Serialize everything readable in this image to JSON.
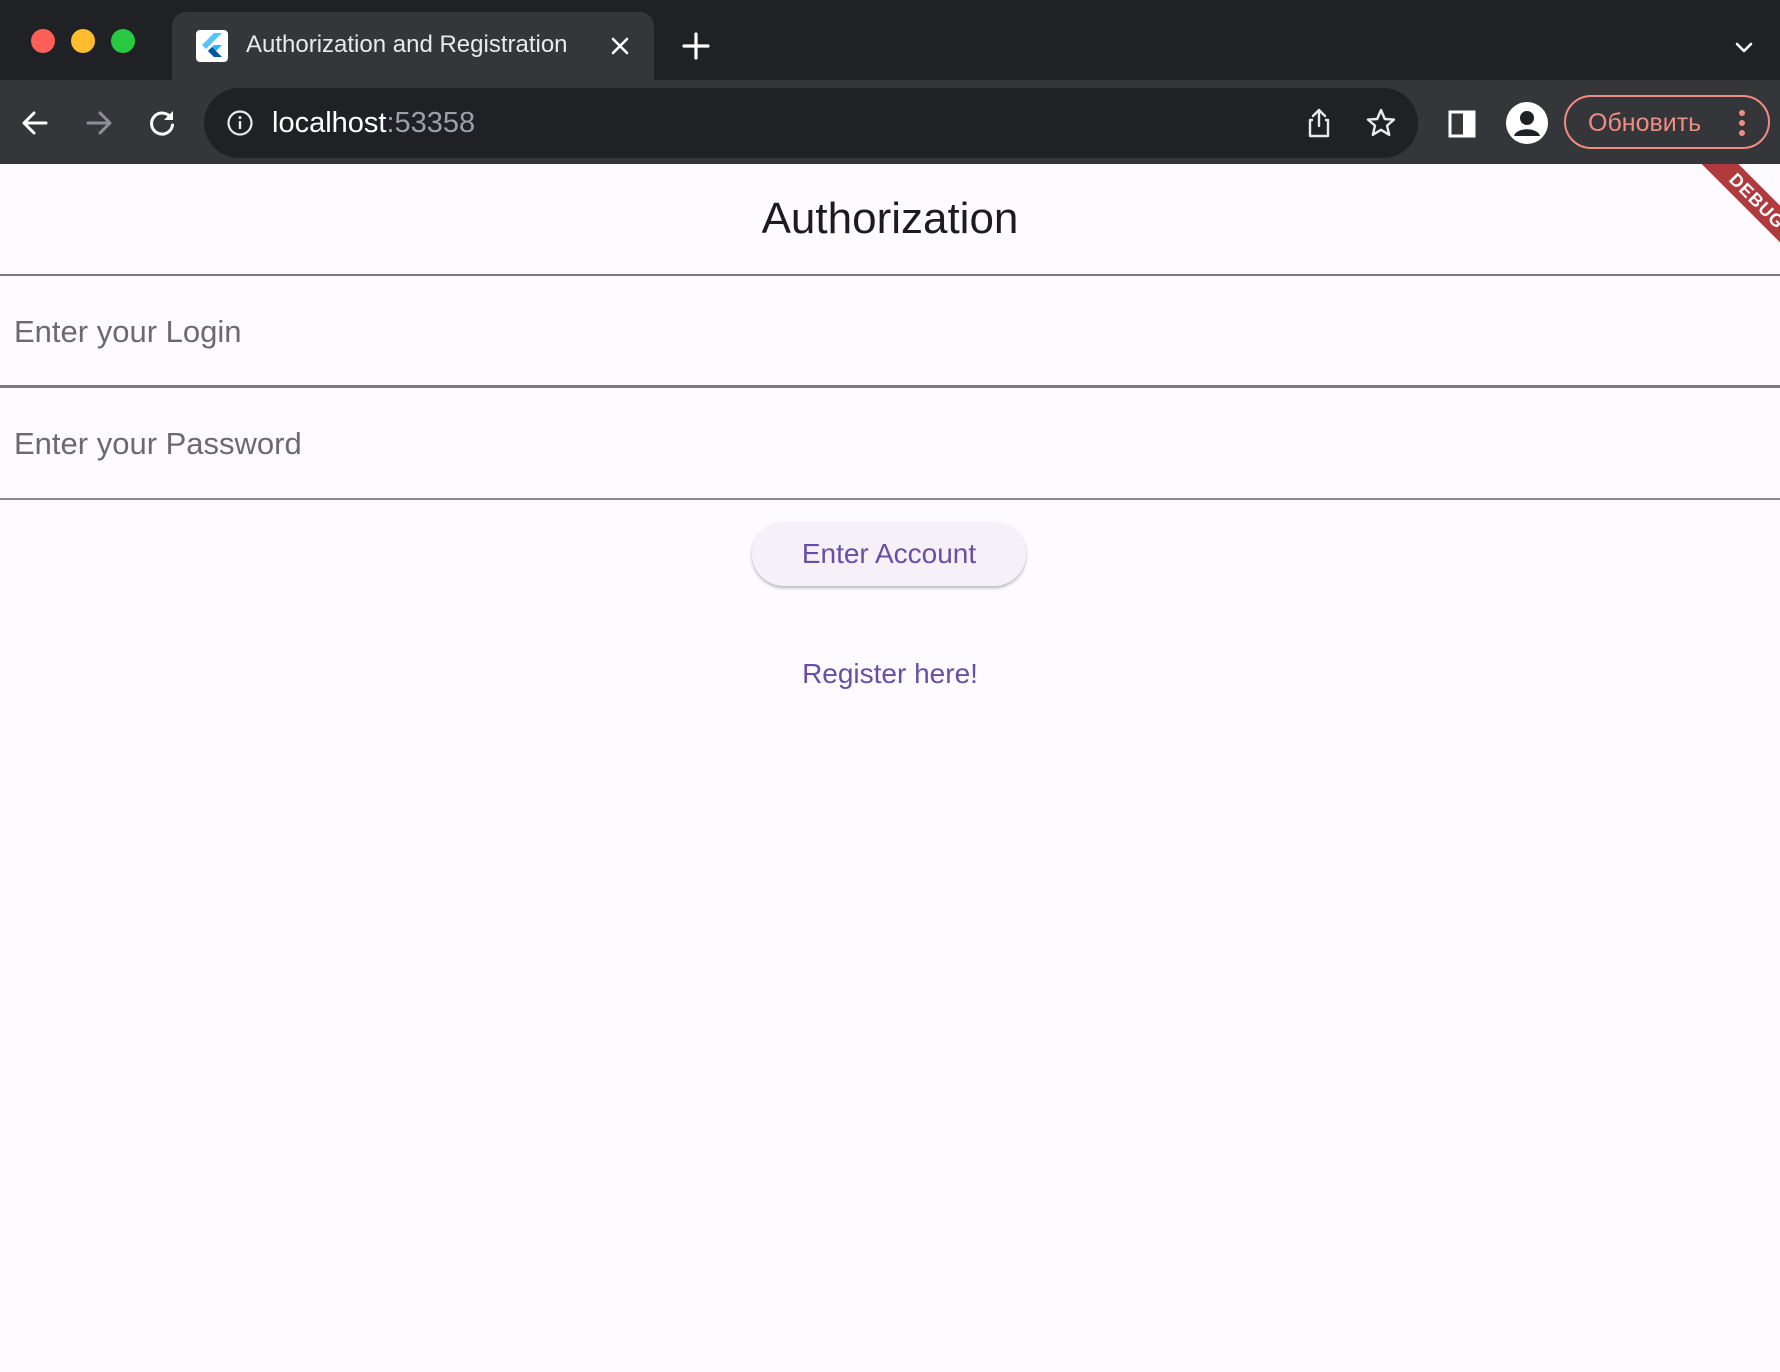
{
  "browser": {
    "tab": {
      "title": "Authorization and Registration",
      "favicon": "flutter-logo-icon"
    },
    "address": {
      "host": "localhost",
      "port": ":53358"
    },
    "update_button": {
      "label": "Обновить"
    },
    "icons": {
      "back": "arrow-left-icon",
      "forward": "arrow-right-icon",
      "reload": "reload-icon",
      "info": "info-icon",
      "share": "share-icon",
      "bookmark": "star-icon",
      "side_panel": "side-panel-icon",
      "profile": "person-icon",
      "menu": "kebab-menu-icon",
      "tab_search": "chevron-down-icon"
    }
  },
  "page": {
    "title": "Authorization",
    "login_field": {
      "placeholder": "Enter your Login",
      "value": ""
    },
    "password_field": {
      "placeholder": "Enter your Password",
      "value": ""
    },
    "enter_button": "Enter Account",
    "register_link": "Register here!",
    "debug_banner": "DEBUG"
  },
  "colors": {
    "accent": "#6750a4",
    "debug_banner": "#b13b3c",
    "update_accent": "#f28b82",
    "page_background": "#fdfbff"
  }
}
